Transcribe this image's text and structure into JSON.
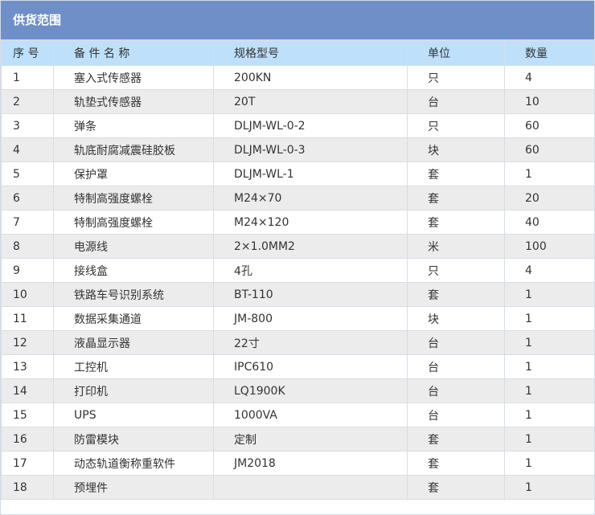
{
  "panel": {
    "title": "供货范围"
  },
  "table": {
    "headers": {
      "idx": "序 号",
      "name": "备 件 名 称",
      "spec": "规格型号",
      "unit": "单位",
      "qty": "数量"
    },
    "rows": [
      {
        "idx": "1",
        "name": "塞入式传感器",
        "spec": "200KN",
        "unit": "只",
        "qty": "4"
      },
      {
        "idx": "2",
        "name": "轨垫式传感器",
        "spec": "20T",
        "unit": "台",
        "qty": "10"
      },
      {
        "idx": "3",
        "name": "弹条",
        "spec": "DLJM-WL-0-2",
        "unit": "只",
        "qty": "60"
      },
      {
        "idx": "4",
        "name": "轨底耐腐减震硅胶板",
        "spec": "DLJM-WL-0-3",
        "unit": "块",
        "qty": "60"
      },
      {
        "idx": "5",
        "name": "保护罩",
        "spec": "DLJM-WL-1",
        "unit": "套",
        "qty": "1"
      },
      {
        "idx": "6",
        "name": "特制高强度螺栓",
        "spec": "M24×70",
        "unit": "套",
        "qty": "20"
      },
      {
        "idx": "7",
        "name": "特制高强度螺栓",
        "spec": "M24×120",
        "unit": "套",
        "qty": "40"
      },
      {
        "idx": "8",
        "name": "电源线",
        "spec": "2×1.0MM2",
        "unit": "米",
        "qty": "100"
      },
      {
        "idx": "9",
        "name": "接线盒",
        "spec": "4孔",
        "unit": "只",
        "qty": "4"
      },
      {
        "idx": "10",
        "name": "铁路车号识别系统",
        "spec": "BT-110",
        "unit": "套",
        "qty": "1"
      },
      {
        "idx": "11",
        "name": "数据采集通道",
        "spec": "JM-800",
        "unit": "块",
        "qty": "1"
      },
      {
        "idx": "12",
        "name": "液晶显示器",
        "spec": "22寸",
        "unit": "台",
        "qty": "1"
      },
      {
        "idx": "13",
        "name": "工控机",
        "spec": "IPC610",
        "unit": "台",
        "qty": "1"
      },
      {
        "idx": "14",
        "name": "打印机",
        "spec": "LQ1900K",
        "unit": "台",
        "qty": "1"
      },
      {
        "idx": "15",
        "name": "UPS",
        "spec": "1000VA",
        "unit": "台",
        "qty": "1"
      },
      {
        "idx": "16",
        "name": "防雷模块",
        "spec": "定制",
        "unit": "套",
        "qty": "1"
      },
      {
        "idx": "17",
        "name": "动态轨道衡称重软件",
        "spec": "JM2018",
        "unit": "套",
        "qty": "1"
      },
      {
        "idx": "18",
        "name": "预埋件",
        "spec": "",
        "unit": "套",
        "qty": "1"
      }
    ]
  }
}
